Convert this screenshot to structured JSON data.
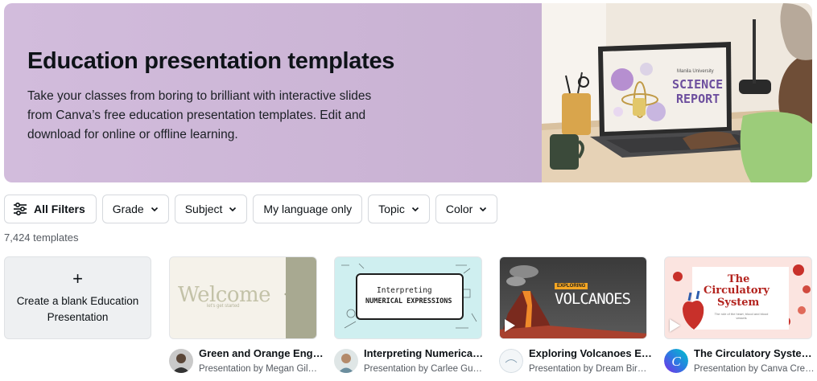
{
  "hero": {
    "title": "Education presentation templates",
    "description": "Take your classes from boring to brilliant with interactive slides from Canva’s free education presentation templates. Edit and download for online or offline learning.",
    "laptop_screen": {
      "school": "Manila University",
      "line1": "SCIENCE",
      "line2": "REPORT"
    }
  },
  "filters": [
    {
      "label": "All Filters"
    },
    {
      "label": "Grade"
    },
    {
      "label": "Subject"
    },
    {
      "label": "My language only"
    },
    {
      "label": "Topic"
    },
    {
      "label": "Color"
    }
  ],
  "count_label": "7,424 templates",
  "blank_card": {
    "plus": "+",
    "label": "Create a blank Education Presentation"
  },
  "cards": [
    {
      "title": "Green and Orange Eng…",
      "subtitle": "Presentation by Megan Gil…",
      "thumb": {
        "main": "Welcome",
        "small": "let's get started"
      }
    },
    {
      "title": "Interpreting Numerica…",
      "subtitle": "Presentation by Carlee Gu…",
      "thumb": {
        "line1": "Interpreting",
        "line2": "NUMERICAL EXPRESSIONS"
      }
    },
    {
      "title": "Exploring Volcanoes E…",
      "subtitle": "Presentation by Dream Bir…",
      "thumb": {
        "tag": "EXPLORING",
        "main": "VOLCANOES"
      }
    },
    {
      "title": "The Circulatory Syste…",
      "subtitle": "Presentation by Canva Cre…",
      "thumb": {
        "line1": "The",
        "line2": "Circulatory",
        "line3": "System",
        "small": "The role of the heart, blood and blood vessels"
      }
    }
  ],
  "colors": {
    "hero_bg": "#cbb4d4",
    "text_primary": "#0d1216",
    "text_secondary": "#555a61",
    "border": "#d5d8dd"
  }
}
